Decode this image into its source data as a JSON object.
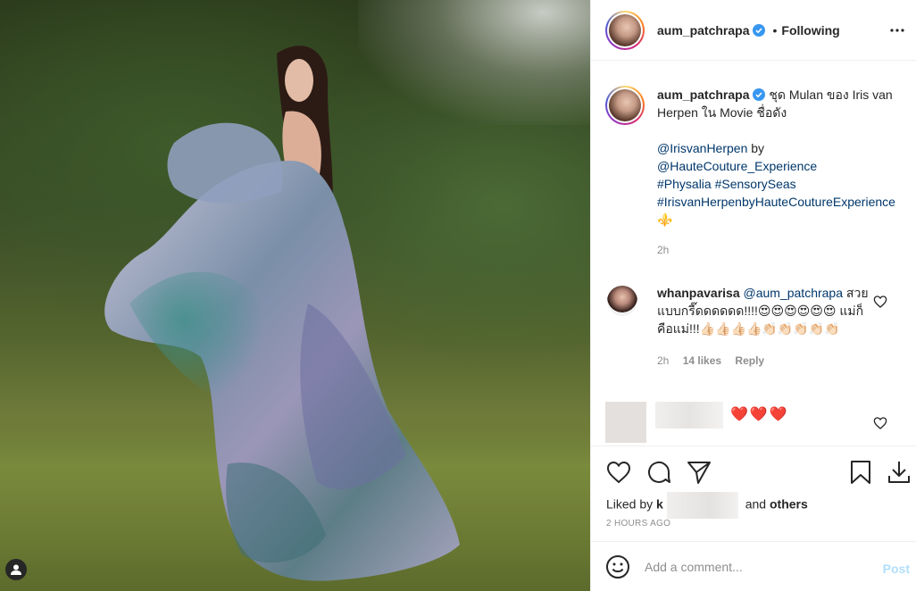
{
  "post": {
    "username": "aum_patchrapa",
    "follow_status": "Following",
    "dot": "•"
  },
  "caption": {
    "username": "aum_patchrapa",
    "text": "ชุด Mulan ของ Iris van Herpen ใน Movie ชื่อดัง",
    "mention1": "@IrisvanHerpen",
    "by": "by",
    "mention2": "@HauteCouture_Experience",
    "tag1": "#Physalia",
    "tag2": "#SensorySeas",
    "tag3": "#IrisvanHerpenbyHauteCoutureExperience",
    "tail_emoji": "⚜️",
    "time": "2h"
  },
  "comment1": {
    "username": "whanpavarisa",
    "mention": "@aum_patchrapa",
    "text": "สวยแบบกรี๊ดดดดดด!!!!😍😍😍😍😍😍 แม่ก็คือแม่!!!👍🏻👍🏻👍🏻👍🏻👏🏻👏🏻👏🏻👏🏻👏🏻",
    "time": "2h",
    "likes": "14 likes",
    "reply": "Reply"
  },
  "comment2": {
    "hearts": "❤️❤️❤️"
  },
  "likes": {
    "prefix": "Liked by",
    "first_letter": "k",
    "and": "and",
    "others": "others"
  },
  "timestamp": "2 HOURS AGO",
  "add_comment": {
    "placeholder": "Add a comment...",
    "post_label": "Post"
  },
  "colors": {
    "text": "#262626",
    "muted": "#8e8e8e",
    "link": "#00376b",
    "verified": "#3897f0",
    "post_disabled": "#b2dffc",
    "heart": "#e0242c"
  }
}
